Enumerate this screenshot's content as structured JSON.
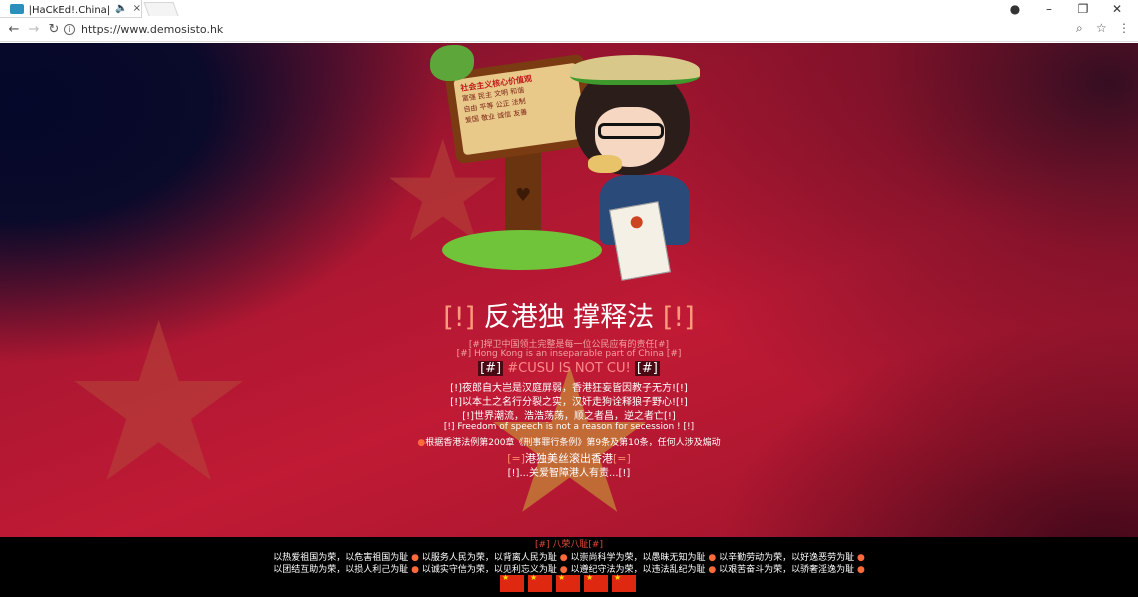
{
  "browser": {
    "tab_title": "|HaCkEd!.China|上|C",
    "tab_audio_icon": "speaker-icon",
    "tab_close": "×",
    "url": "https://www.demosisto.hk",
    "window_controls": {
      "account": "account-icon",
      "minimize": "–",
      "maximize": "❐",
      "close": "✕"
    }
  },
  "sign": {
    "header": "社会主义核心价值观",
    "rows": [
      "富强 民主 文明 和谐",
      "自由 平等 公正 法制",
      "爱国 敬业 诚信 友善"
    ]
  },
  "content": {
    "headline_open": "[!]",
    "headline_text": " 反港独 撑释法 ",
    "headline_close": "[!]",
    "line1": "[#]捍卫中国领土完整是每一位公民应有的责任[#]",
    "line2": "[#] Hong Kong is an inseparable part of China [#]",
    "line3_hash_open": "[#]",
    "line3_text": " #CUSU IS NOT CU! ",
    "line3_hash_close": "[#]",
    "line4": "[!]夜郎自大岂是汉庭屏弱，香港狂妄皆因教子无方![!]",
    "line5": "[!]以本土之名行分裂之实，汉奸走狗诠释狼子野心![!]",
    "line6": "[!]世界潮流，浩浩荡荡，顺之者昌，逆之者亡[!]",
    "line7": "[!] Freedom of speech is not a reason for secession ! [!]",
    "line8_dot": "●",
    "line8": "根据香港法例第200章《刑事罪行条例》第9条及第10条，任何人涉及煽动",
    "line9_open": "[=]",
    "line9_text": "港独美丝滚出香港",
    "line9_close": "[=]",
    "line10": "[!]...关爱智障港人有责...[!]"
  },
  "footer": {
    "line1": "[#] 八荣八耻[#]",
    "line2": [
      "以热爱祖国为荣，以危害祖国为耻",
      "以服务人民为荣，以背离人民为耻",
      "以崇尚科学为荣，以愚昧无知为耻",
      "以辛勤劳动为荣，以好逸恶劳为耻"
    ],
    "line3": [
      "以团结互助为荣，以损人利己为耻",
      "以诚实守信为荣，以见利忘义为耻",
      "以遵纪守法为荣，以违法乱纪为耻",
      "以艰苦奋斗为荣，以骄奢淫逸为耻"
    ],
    "separator": "●",
    "flags": [
      "china-flag-icon",
      "china-flag-icon",
      "china-flag-icon",
      "china-flag-icon",
      "china-flag-icon"
    ]
  },
  "colors": {
    "page_red": "#c01a35",
    "page_dark": "#05082a",
    "accent_orange": "#ff8a6a",
    "footer_bg": "#000000"
  }
}
